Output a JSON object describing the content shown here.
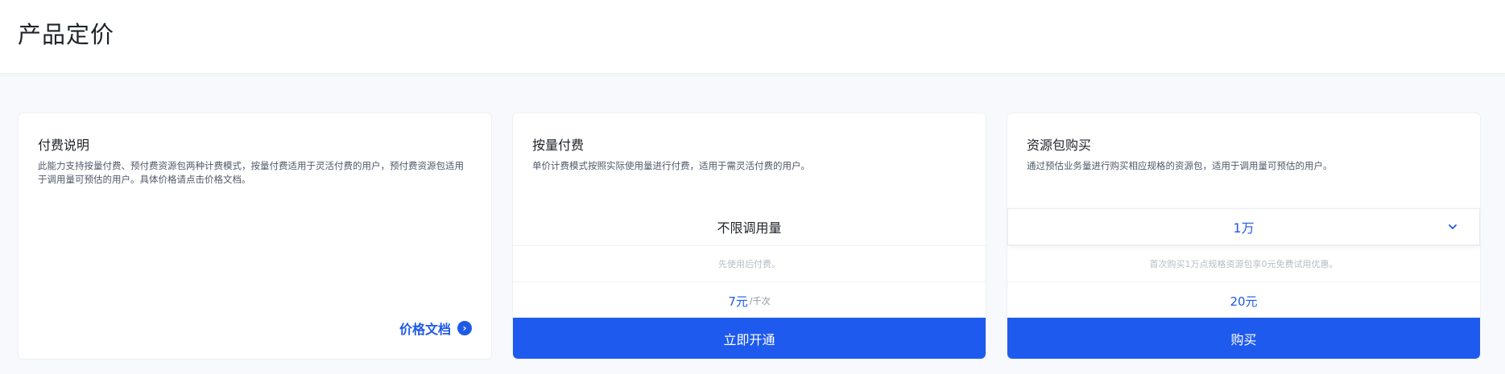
{
  "header": {
    "title": "产品定价"
  },
  "cards": [
    {
      "title": "付费说明",
      "description": "此能力支持按量付费、预付费资源包两种计费模式，按量付费适用于灵活付费的用户，预付费资源包适用于调用量可预估的用户。具体价格请点击价格文档。",
      "link_label": "价格文档",
      "link_icon": "chevron-right-circle-icon"
    },
    {
      "title": "按量付费",
      "description": "单价计费模式按照实际使用量进行付费，适用于需灵活付费的用户。",
      "quota_label": "不限调用量",
      "note": "先使用后付费。",
      "price": "7元",
      "price_unit": "/千次",
      "button_label": "立即开通"
    },
    {
      "title": "资源包购买",
      "description": "通过预估业务量进行购买相应规格的资源包，适用于调用量可预估的用户。",
      "selected_package": "1万",
      "select_icon": "chevron-down-icon",
      "note": "首次购买1万点规格资源包享0元免费试用优惠。",
      "price": "20元",
      "button_label": "购买"
    }
  ],
  "colors": {
    "accent": "#1e5aee",
    "text": "#1f2329",
    "muted": "#b6bcc6",
    "background": "#f7f9fc"
  }
}
